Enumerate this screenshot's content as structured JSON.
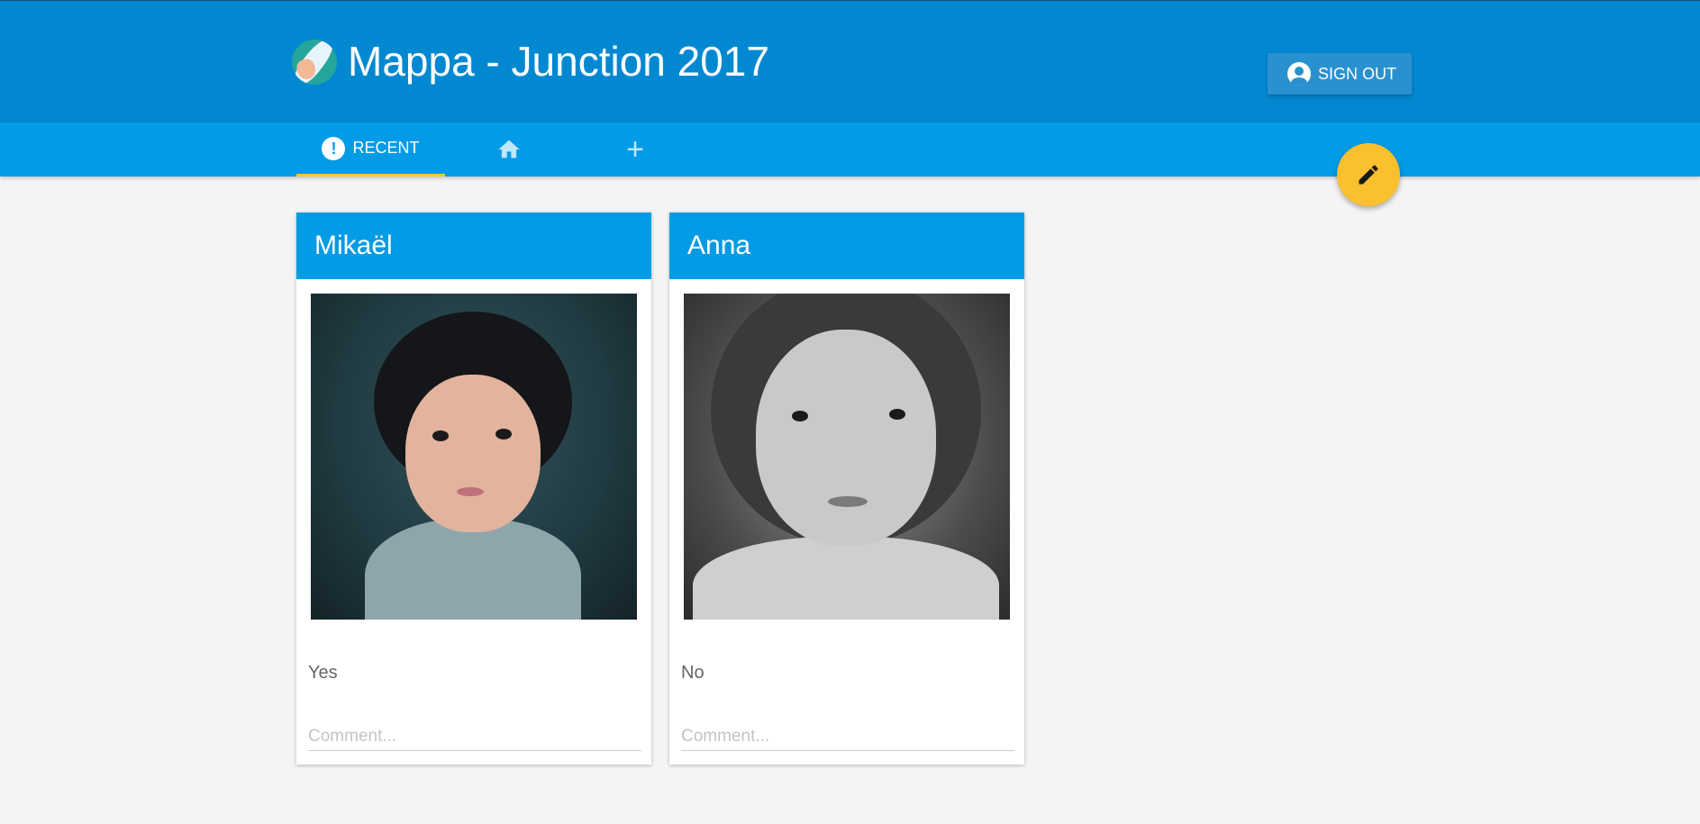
{
  "header": {
    "title": "Mappa - Junction 2017",
    "logo_icon": "feather-hand-logo",
    "signout_label": "SIGN OUT",
    "signout_icon": "account-circle-icon",
    "background": "#0288d1"
  },
  "tabs": [
    {
      "label": "RECENT",
      "icon": "new-releases-icon",
      "active": true
    },
    {
      "label": "",
      "icon": "home-icon",
      "active": false
    },
    {
      "label": "",
      "icon": "add-icon",
      "active": false
    }
  ],
  "tabs_ui": {
    "recent_badge": "!",
    "add_glyph": "+"
  },
  "fab": {
    "icon": "pencil-icon",
    "color": "#fbc02d"
  },
  "cards": [
    {
      "name": "Mikaël",
      "answer": "Yes",
      "comment_placeholder": "Comment...",
      "comment_value": ""
    },
    {
      "name": "Anna",
      "answer": "No",
      "comment_placeholder": "Comment...",
      "comment_value": ""
    }
  ],
  "colors": {
    "tab_bar": "#039be5",
    "active_tab_indicator": "#ffca28",
    "page_background": "#f4f4f4"
  }
}
